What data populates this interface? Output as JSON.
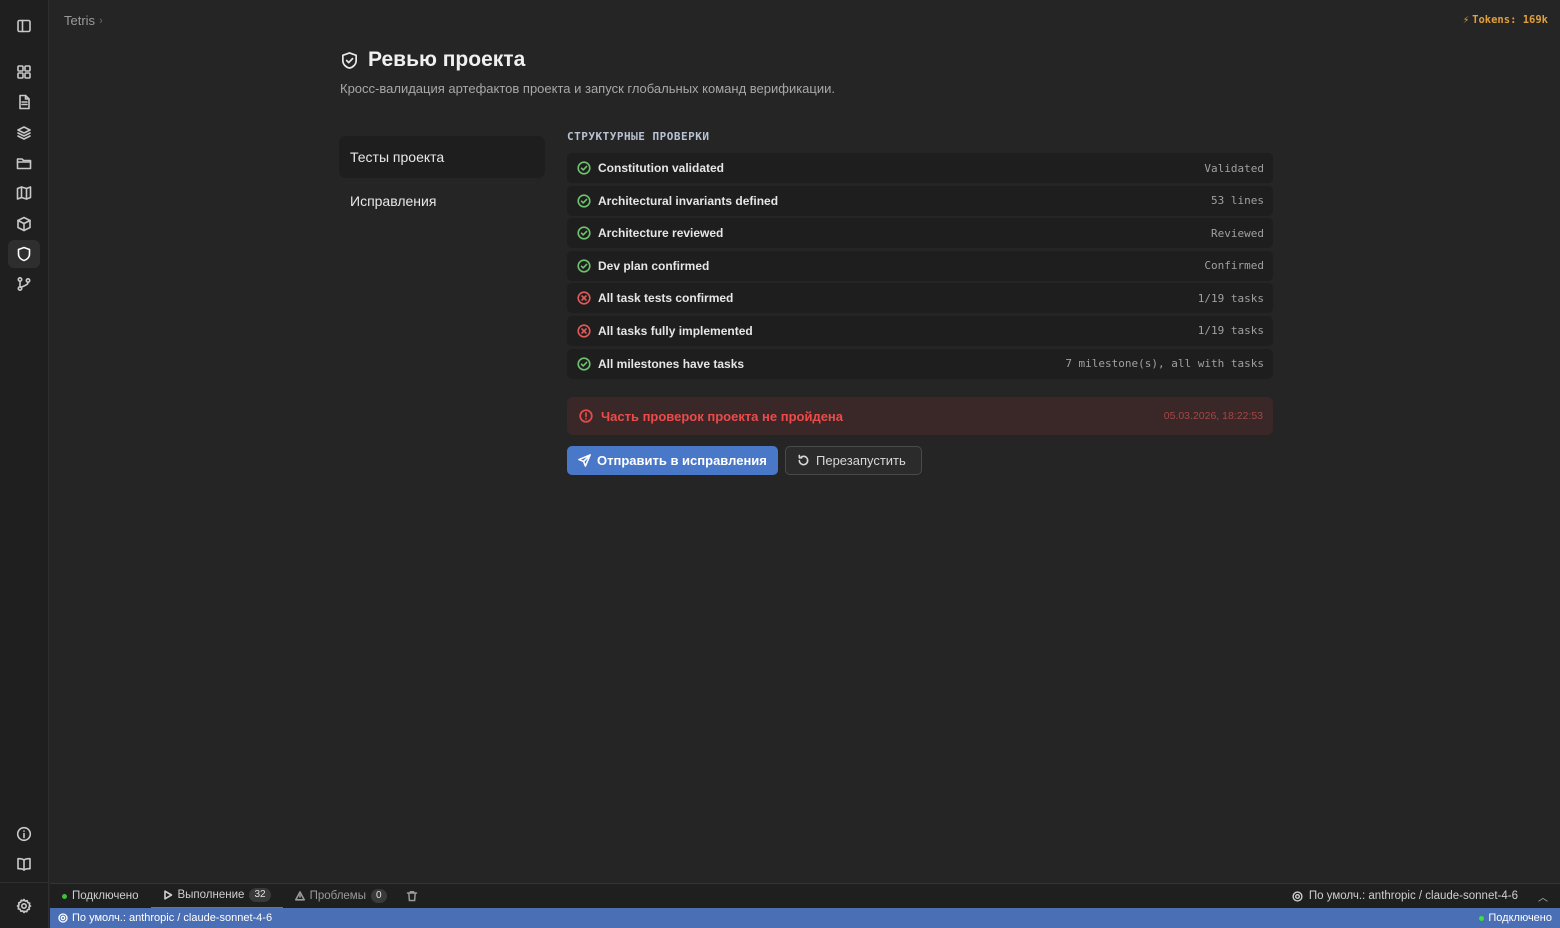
{
  "breadcrumb": {
    "project": "Tetris",
    "separator": "›"
  },
  "tokens": {
    "label": "Tokens: 169k",
    "color": "#e0a03a"
  },
  "header": {
    "title": "Ревью проекта",
    "subtitle": "Кросс-валидация артефактов проекта и запуск глобальных команд верификации."
  },
  "side_menu": {
    "items": [
      {
        "label": "Тесты проекта",
        "active": true
      },
      {
        "label": "Исправления",
        "active": false
      }
    ]
  },
  "checks": {
    "section_title": "СТРУКТУРНЫЕ ПРОВЕРКИ",
    "rows": [
      {
        "label": "Constitution validated",
        "value": "Validated",
        "status": "ok"
      },
      {
        "label": "Architectural invariants defined",
        "value": "53 lines",
        "status": "ok"
      },
      {
        "label": "Architecture reviewed",
        "value": "Reviewed",
        "status": "ok"
      },
      {
        "label": "Dev plan confirmed",
        "value": "Confirmed",
        "status": "ok"
      },
      {
        "label": "All task tests confirmed",
        "value": "1/19 tasks",
        "status": "fail"
      },
      {
        "label": "All tasks fully implemented",
        "value": "1/19 tasks",
        "status": "fail"
      },
      {
        "label": "All milestones have tasks",
        "value": "7 milestone(s), all with tasks",
        "status": "ok"
      }
    ],
    "colors": {
      "ok": "#6ec26e",
      "fail": "#e25a5a"
    }
  },
  "alert": {
    "message": "Часть проверок проекта не пройдена",
    "timestamp": "05.03.2026, 18:22:53",
    "color": "#ee4a4a"
  },
  "actions": {
    "send_label": "Отправить в исправления",
    "restart_label": "Перезапустить",
    "primary_color": "#4a78c8"
  },
  "bottom_panel": {
    "connected_label": "Подключено",
    "run_label": "Выполнение",
    "run_count": "32",
    "problems_label": "Проблемы",
    "problems_count": "0",
    "model_label": "По умолч.: anthropic / claude-sonnet-4-6"
  },
  "status_bar": {
    "model_label": "По умолч.: anthropic / claude-sonnet-4-6",
    "connection_label": "Подключено",
    "color": "#4a6fb5"
  },
  "rail_icons": [
    "sidebar-toggle-icon",
    "dashboard-icon",
    "document-icon",
    "layers-icon",
    "folder-icon",
    "map-icon",
    "package-icon",
    "shield-icon",
    "git-branch-icon",
    "info-icon",
    "book-icon",
    "settings-icon"
  ]
}
